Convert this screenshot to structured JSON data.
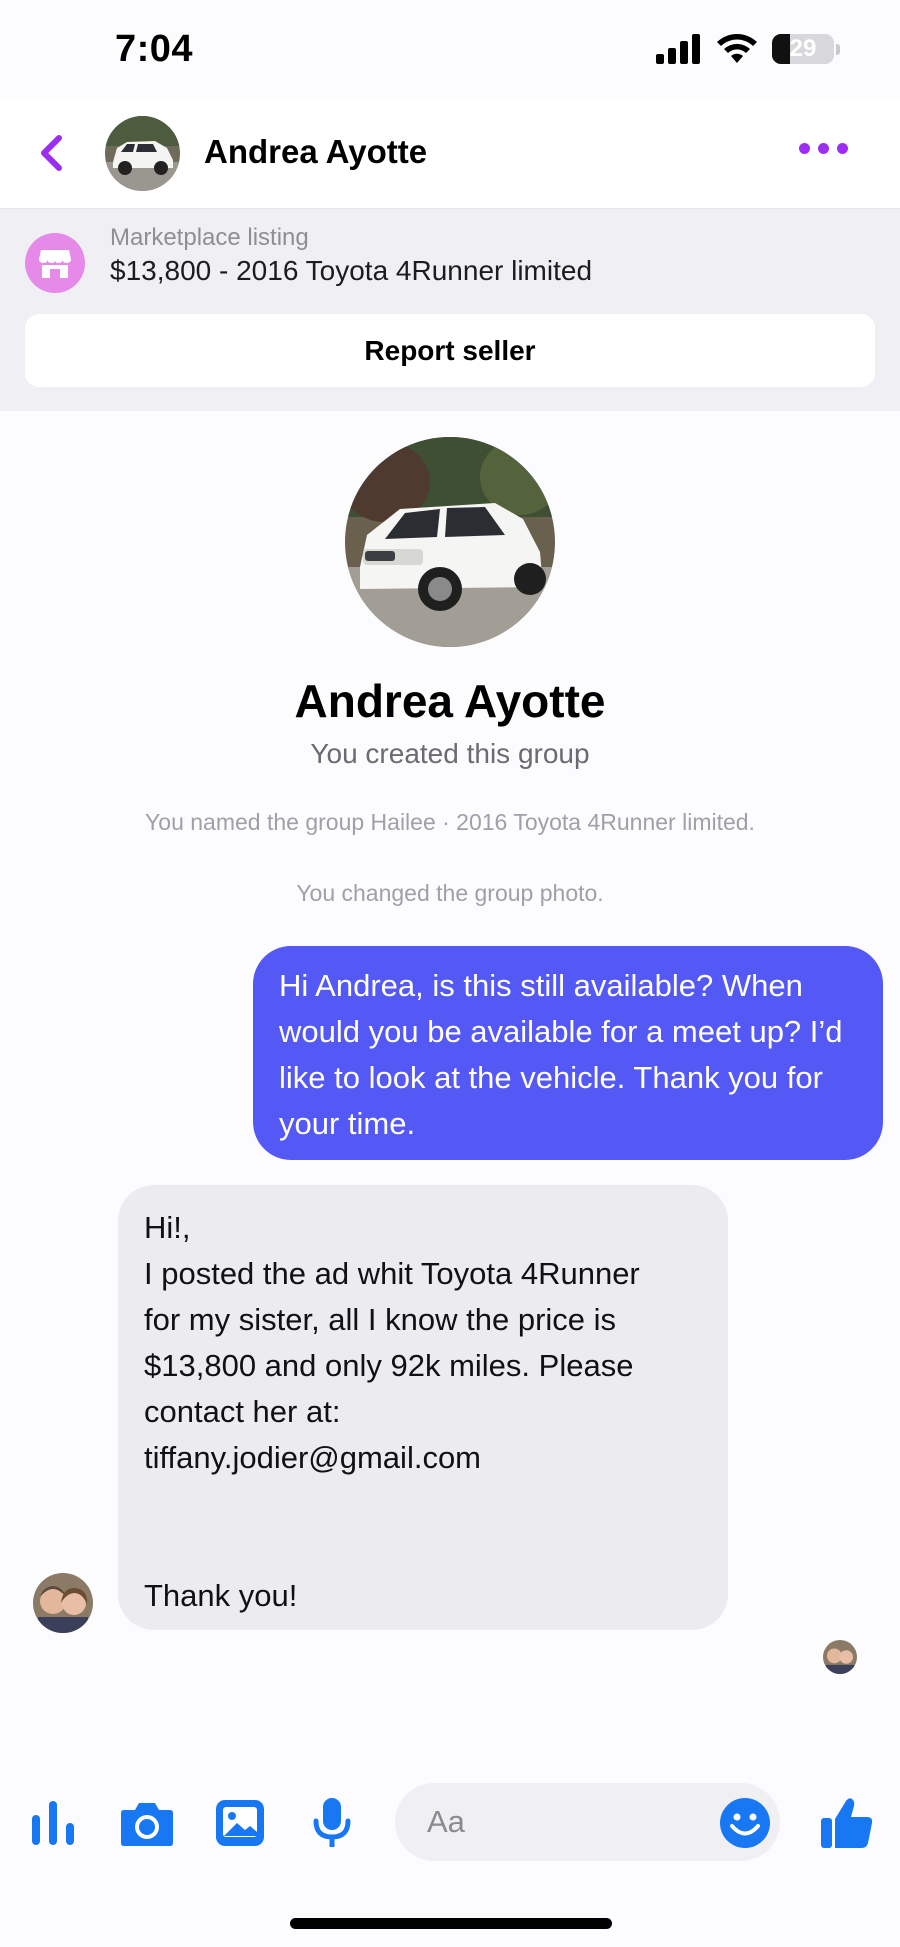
{
  "status_bar": {
    "time": "7:04",
    "battery_level": "29",
    "icons": [
      "signal-icon",
      "wifi-icon",
      "battery-icon"
    ]
  },
  "header": {
    "contact_name": "Andrea Ayotte",
    "icons": [
      "back-chevron-icon",
      "more-dots-icon"
    ],
    "accent_color": "#9b2ef0"
  },
  "marketplace": {
    "label": "Marketplace listing",
    "listing_title": "$13,800 - 2016 Toyota 4Runner limited",
    "report_label": "Report seller",
    "icon": "storefront-icon"
  },
  "group": {
    "name": "Andrea Ayotte",
    "subtitle": "You created this group",
    "system_messages": [
      "You named the group Hailee · 2016 Toyota 4Runner limited.",
      "You changed the group photo."
    ]
  },
  "messages": [
    {
      "direction": "outgoing",
      "text": "Hi Andrea, is this still available? When would you be available for a meet up? I’d like to look at the vehicle. Thank you for your time.",
      "color": "#5458f5"
    },
    {
      "direction": "incoming",
      "lines": [
        "Hi!,",
        "I posted the ad whit Toyota 4Runner",
        "for my sister, all I know the price is",
        "$13,800 and only 92k miles. Please",
        "contact her at:",
        "tiffany.jodier@gmail.com",
        "",
        "",
        "Thank you!"
      ],
      "color": "#ececf0"
    }
  ],
  "composer": {
    "placeholder": "Aa",
    "buttons": [
      "audio-bars-icon",
      "camera-icon",
      "photo-gallery-icon",
      "microphone-icon",
      "emoji-icon",
      "thumbs-up-icon"
    ],
    "icon_color": "#1877f2"
  }
}
